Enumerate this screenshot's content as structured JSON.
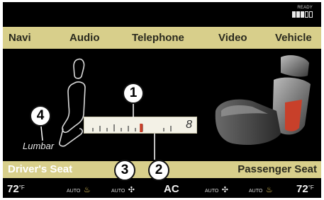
{
  "status": {
    "ready_label": "READY",
    "bars_full": 3,
    "bars_total": 5
  },
  "nav": {
    "items": [
      "Navi",
      "Audio",
      "Telephone",
      "Video",
      "Vehicle"
    ]
  },
  "lumbar": {
    "label": "Lumbar",
    "scale_value": "8",
    "level_fraction": 0.62
  },
  "callouts": [
    "1",
    "2",
    "3",
    "4"
  ],
  "seat_bar": {
    "driver": "Driver's Seat",
    "passenger": "Passenger Seat"
  },
  "climate": {
    "left_temp": "72",
    "right_temp": "72",
    "temp_unit": "°F",
    "auto_label": "AUTO",
    "ac_label": "AC"
  },
  "colors": {
    "bar_bg": "#d8cf8b",
    "screen_bg": "#000000",
    "accent_red": "#c8402a"
  },
  "icons": [
    "seat-heat-icon",
    "fan-icon",
    "seat-outline-icon",
    "lumbar-support-icon"
  ]
}
